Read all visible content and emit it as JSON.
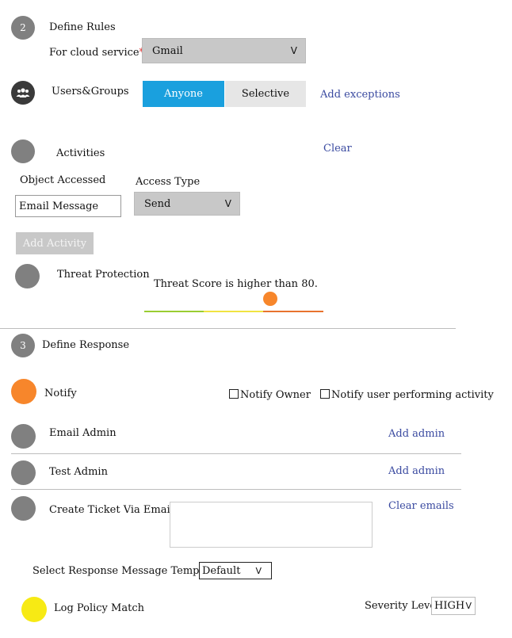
{
  "rules": {
    "step": "2",
    "title": "Define Rules",
    "cloud_service_label": "For cloud service",
    "required_mark": "*",
    "cloud_service_value": "Gmail",
    "chevron": "V",
    "users_groups_label": "Users&Groups",
    "users_icon": "users-group-icon",
    "anyone": "Anyone",
    "selective": "Selective",
    "add_exceptions": "Add exceptions",
    "activities": "Activities",
    "clear": "Clear",
    "object_accessed": "Object Accessed",
    "object_accessed_value": "Email Message",
    "access_type": "Access Type",
    "access_type_value": "Send",
    "add_activity": "Add Activity",
    "threat_protection": "Threat Protection",
    "threat_score_text": "Threat Score is higher than 80.",
    "threat_score_value": 80,
    "slider_colors": [
      "#9acd32",
      "#f0e442",
      "#e8732e"
    ]
  },
  "response": {
    "step": "3",
    "title": "Define Response",
    "notify": "Notify",
    "notify_owner": "Notify Owner",
    "notify_user": "Notify user performing activity",
    "email_admin": "Email Admin",
    "add_admin_1": "Add admin",
    "test_admin": "Test Admin",
    "add_admin_2": "Add admin",
    "create_ticket": "Create Ticket Via Email",
    "clear_emails": "Clear emails",
    "template_label": "Select Response Message Template",
    "template_value": "Default",
    "log_policy": "Log Policy Match",
    "severity_label": "Severity Level",
    "severity_value": "HIGH"
  },
  "colors": {
    "accent_blue": "#1aa0de",
    "orange": "#f7862b",
    "yellow": "#f7ea14",
    "grey_circle": "#808080",
    "link": "#3a4aa0"
  }
}
